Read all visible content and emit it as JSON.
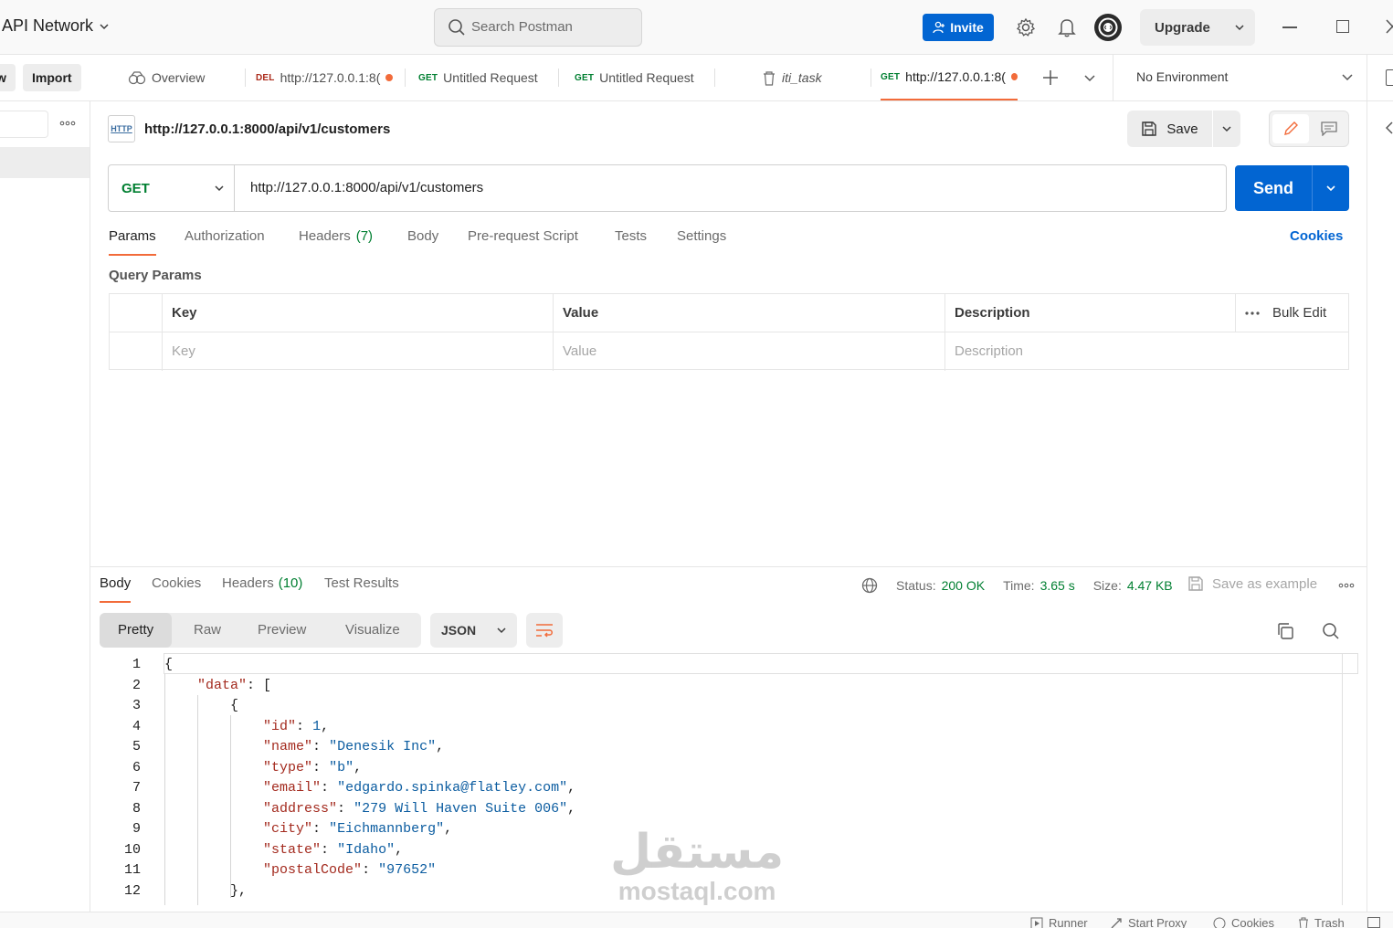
{
  "topbar": {
    "workspace_title": "API Network",
    "search_placeholder": "Search Postman",
    "invite_label": "Invite",
    "upgrade_label": "Upgrade"
  },
  "sidebar": {
    "new_label": "w",
    "import_label": "Import"
  },
  "tabs": [
    {
      "method": "",
      "label": "Overview"
    },
    {
      "method": "DEL",
      "label": "http://127.0.0.1:8("
    },
    {
      "method": "GET",
      "label": "Untitled Request"
    },
    {
      "method": "GET",
      "label": "Untitled Request"
    },
    {
      "method": "",
      "label": "iti_task"
    },
    {
      "method": "GET",
      "label": "http://127.0.0.1:8("
    }
  ],
  "environment": "No Environment",
  "request": {
    "title": "http://127.0.0.1:8000/api/v1/customers",
    "http_badge": "HTTP",
    "save_label": "Save",
    "method": "GET",
    "url": "http://127.0.0.1:8000/api/v1/customers",
    "send_label": "Send",
    "tabs": {
      "params": "Params",
      "authorization": "Authorization",
      "headers": "Headers",
      "headers_count": "(7)",
      "body": "Body",
      "prerequest": "Pre-request Script",
      "tests": "Tests",
      "settings": "Settings",
      "cookies": "Cookies"
    },
    "query_params_title": "Query Params",
    "table": {
      "key_header": "Key",
      "value_header": "Value",
      "description_header": "Description",
      "bulk_edit": "Bulk Edit",
      "key_placeholder": "Key",
      "value_placeholder": "Value",
      "description_placeholder": "Description"
    }
  },
  "response": {
    "tabs": {
      "body": "Body",
      "cookies": "Cookies",
      "headers": "Headers",
      "headers_count": "(10)",
      "test_results": "Test Results"
    },
    "status_label": "Status:",
    "status_value": "200 OK",
    "time_label": "Time:",
    "time_value": "3.65 s",
    "size_label": "Size:",
    "size_value": "4.47 KB",
    "save_example": "Save as example",
    "view_tabs": [
      "Pretty",
      "Raw",
      "Preview",
      "Visualize"
    ],
    "format": "JSON",
    "line_numbers": [
      "1",
      "2",
      "3",
      "4",
      "5",
      "6",
      "7",
      "8",
      "9",
      "10",
      "11",
      "12"
    ],
    "json": {
      "data_key": "\"data\"",
      "id_key": "\"id\"",
      "id_val": "1",
      "name_key": "\"name\"",
      "name_val": "\"Denesik Inc\"",
      "type_key": "\"type\"",
      "type_val": "\"b\"",
      "email_key": "\"email\"",
      "email_val": "\"edgardo.spinka@flatley.com\"",
      "address_key": "\"address\"",
      "address_val": "\"279 Will Haven Suite 006\"",
      "city_key": "\"city\"",
      "city_val": "\"Eichmannberg\"",
      "state_key": "\"state\"",
      "state_val": "\"Idaho\"",
      "postal_key": "\"postalCode\"",
      "postal_val": "\"97652\""
    }
  },
  "statusbar": {
    "runner": "Runner",
    "start_proxy": "Start Proxy",
    "cookies": "Cookies",
    "trash": "Trash"
  },
  "watermark": {
    "arabic": "مستقل",
    "latin": "mostaql.com"
  },
  "colors": {
    "accent": "#f26b3a",
    "primary": "#0265d2",
    "status_ok": "#007f31"
  }
}
